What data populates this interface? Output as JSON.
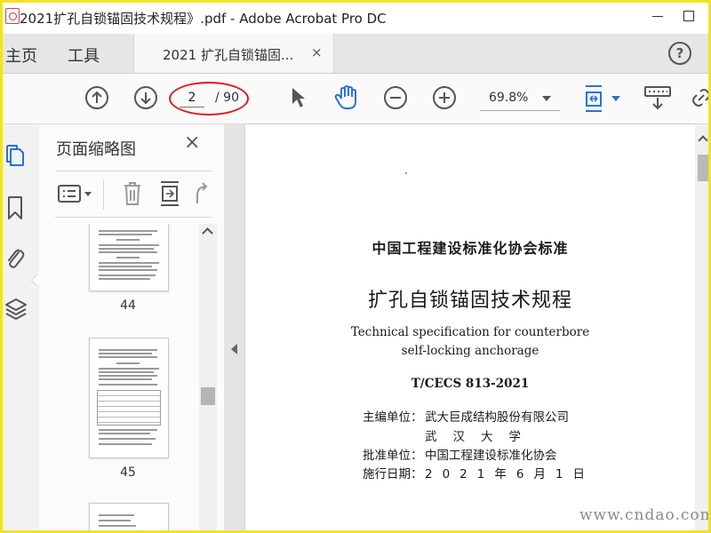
{
  "window": {
    "title": "2021扩孔自锁锚固技术规程》.pdf - Adobe Acrobat Pro DC",
    "minimize_icon": "minimize-icon",
    "maximize_icon": "maximize-icon"
  },
  "tabs": {
    "home": "主页",
    "tools": "工具",
    "document": "2021 扩孔自锁锚固...",
    "close": "×",
    "help": "?"
  },
  "toolbar": {
    "current_page": "2",
    "total_pages": "/ 90",
    "zoom": "69.8%",
    "annotation_color": "#e01b1b",
    "accent_color": "#2a72d8"
  },
  "thumbnails": {
    "title": "页面缩略图",
    "close": "×",
    "pages": [
      {
        "number": "44"
      },
      {
        "number": "45"
      }
    ]
  },
  "document": {
    "org": "中国工程建设标准化协会标准",
    "title": "扩孔自锁锚固技术规程",
    "english_line1": "Technical specification for counterbore",
    "english_line2": "self-locking anchorage",
    "code": "T/CECS 813-2021",
    "rows": [
      {
        "label": "主编单位：",
        "value": "武大巨成结构股份有限公司"
      },
      {
        "label": "",
        "value": "武汉大学"
      },
      {
        "label": "批准单位：",
        "value": "中国工程建设标准化协会"
      },
      {
        "label": "施行日期：",
        "value": "2021年6月1日"
      }
    ]
  },
  "watermark": "www.cndao.com"
}
